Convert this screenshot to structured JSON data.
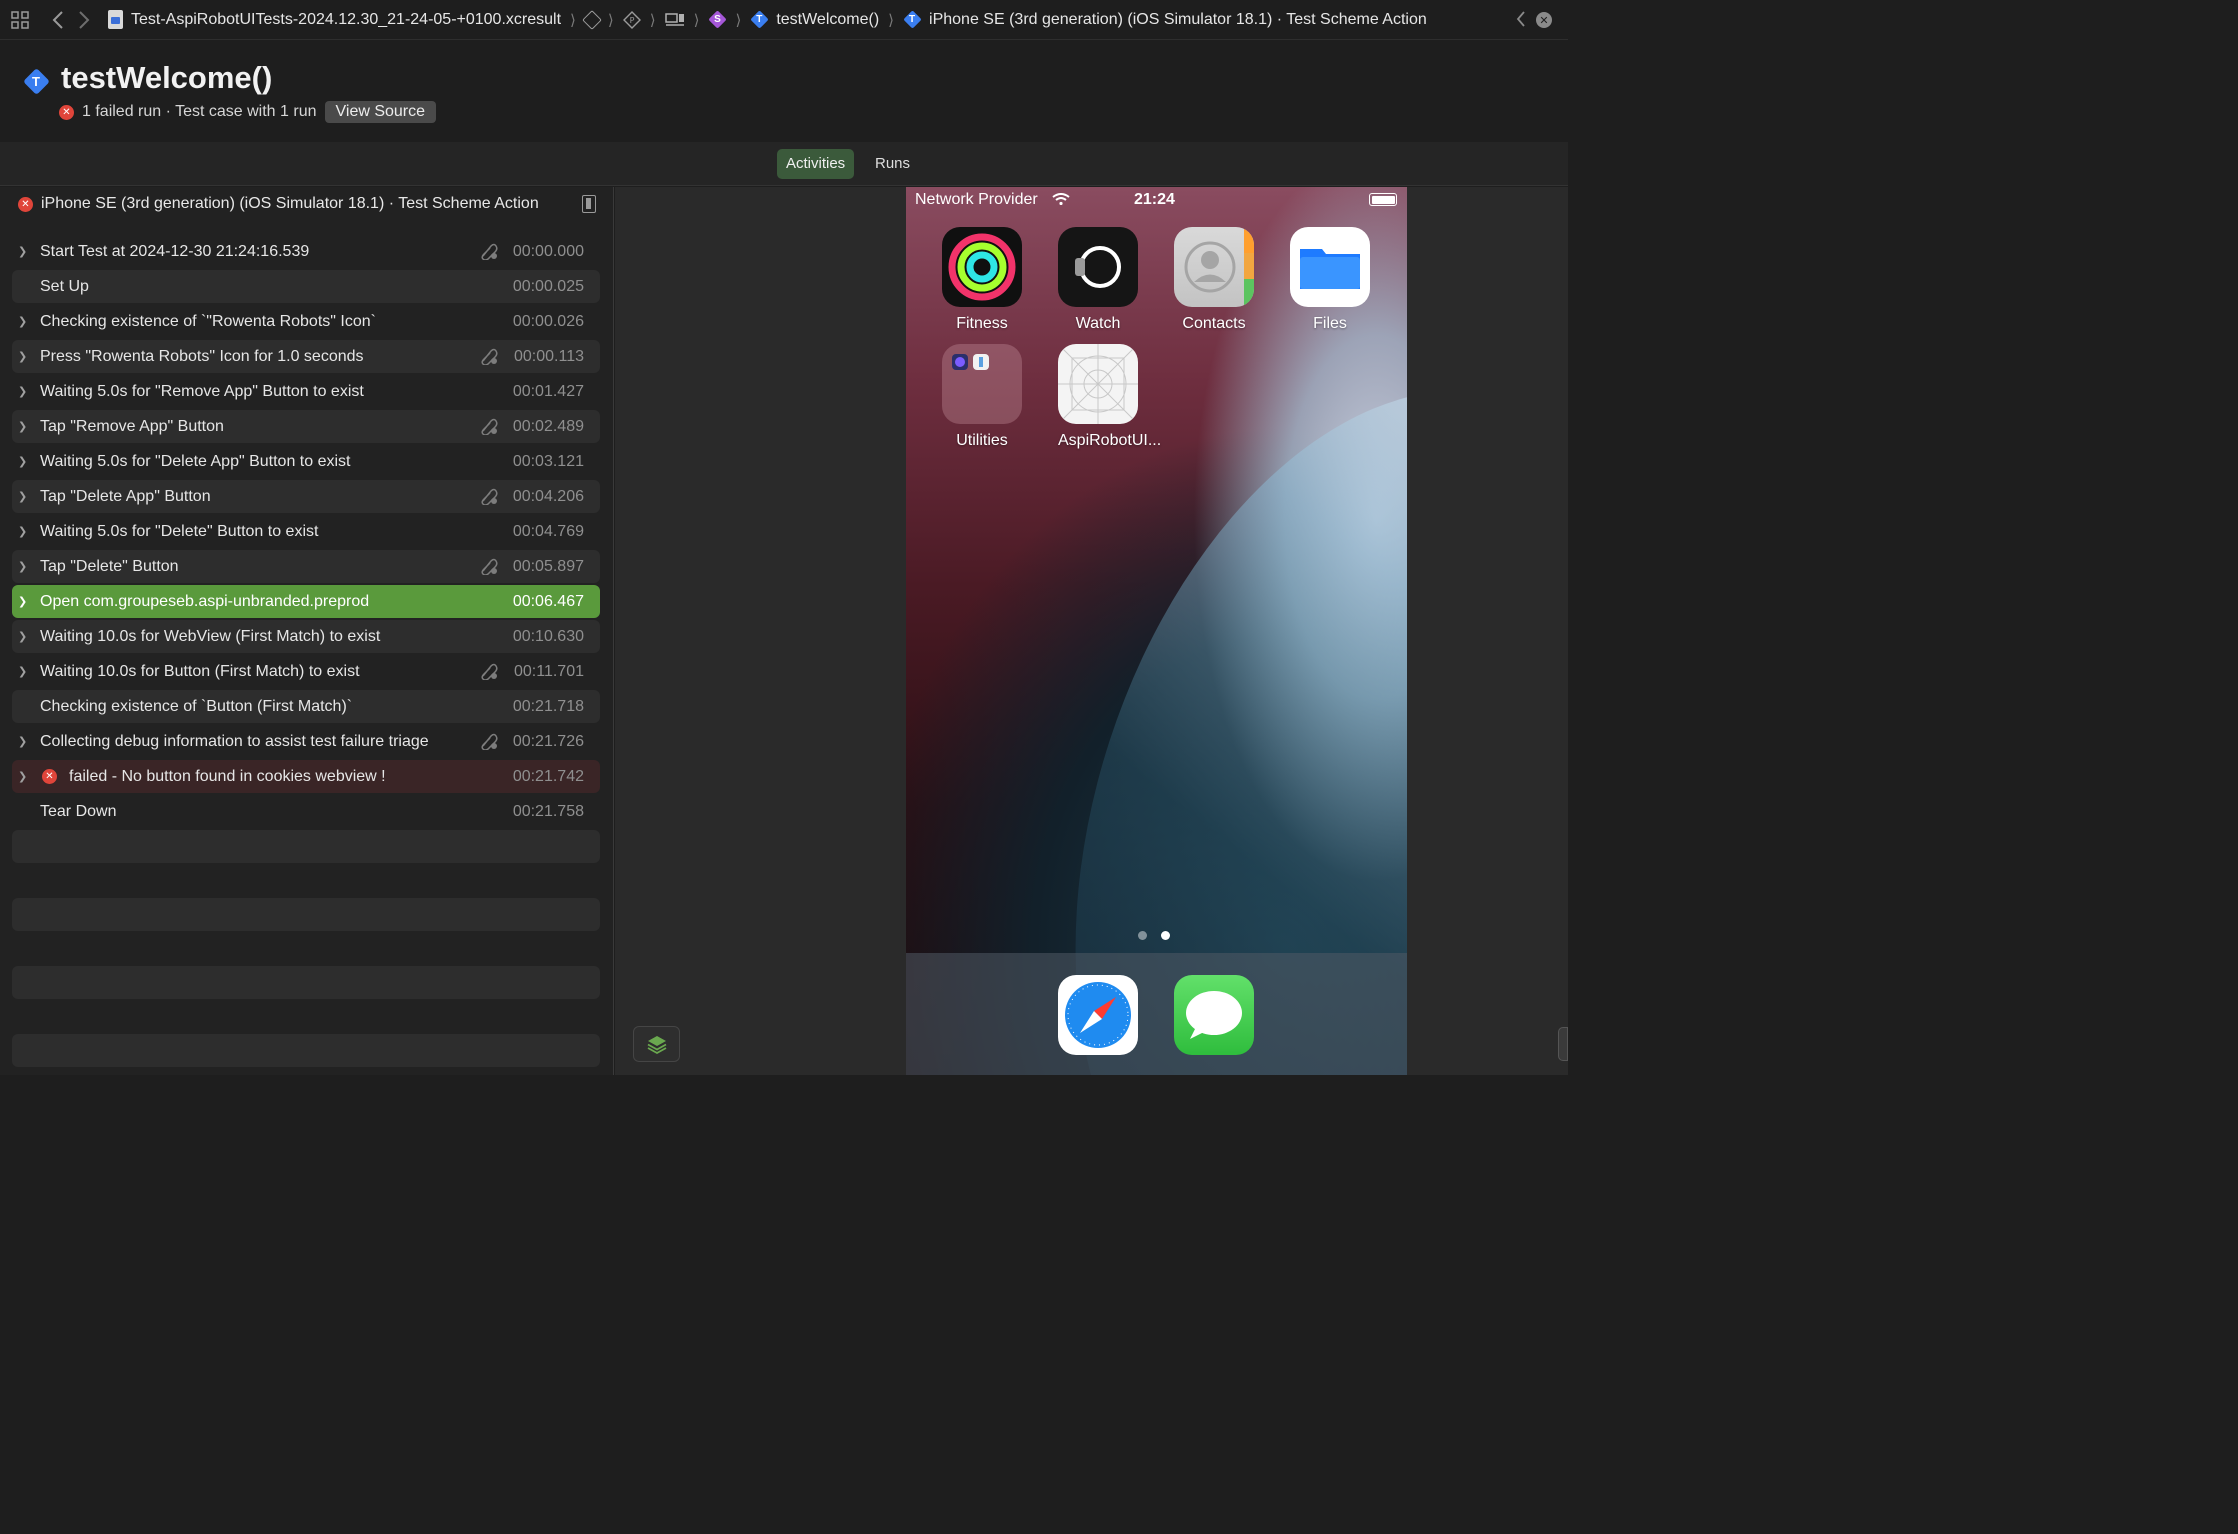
{
  "breadcrumb": {
    "file": "Test-AspiRobotUITests-2024.12.30_21-24-05-+0100.xcresult",
    "test_badge_letter": "T",
    "scheme_badge_letter": "S",
    "test": "testWelcome()",
    "destination": "iPhone SE (3rd generation) (iOS Simulator 18.1) · Test Scheme Action"
  },
  "header": {
    "badge_letter": "T",
    "title": "testWelcome()",
    "summary": "1 failed run · Test case with 1 run",
    "view_source_label": "View Source"
  },
  "tabs": {
    "activities": "Activities",
    "runs": "Runs"
  },
  "run_panel": {
    "title": "iPhone SE (3rd generation) (iOS Simulator 18.1) · Test Scheme Action",
    "activities": [
      {
        "label": "Start Test at 2024-12-30 21:24:16.539",
        "time": "00:00.000"
      },
      {
        "label": "Set Up",
        "time": "00:00.025"
      },
      {
        "label": "Checking existence of `\"Rowenta Robots\" Icon`",
        "time": "00:00.026"
      },
      {
        "label": "Press \"Rowenta Robots\" Icon for 1.0 seconds",
        "time": "00:00.113"
      },
      {
        "label": "Waiting 5.0s for \"Remove App\" Button to exist",
        "time": "00:01.427"
      },
      {
        "label": "Tap \"Remove App\" Button",
        "time": "00:02.489"
      },
      {
        "label": "Waiting 5.0s for \"Delete App\" Button to exist",
        "time": "00:03.121"
      },
      {
        "label": "Tap \"Delete App\" Button",
        "time": "00:04.206"
      },
      {
        "label": "Waiting 5.0s for \"Delete\" Button to exist",
        "time": "00:04.769"
      },
      {
        "label": "Tap \"Delete\" Button",
        "time": "00:05.897"
      },
      {
        "label": "Open com.groupeseb.aspi-unbranded.preprod",
        "time": "00:06.467"
      },
      {
        "label": "Waiting 10.0s for WebView (First Match) to exist",
        "time": "00:10.630"
      },
      {
        "label": "Waiting 10.0s for Button (First Match) to exist",
        "time": "00:11.701"
      },
      {
        "label": "Checking existence of `Button (First Match)`",
        "time": "00:21.718"
      },
      {
        "label": "Collecting debug information to assist test failure triage",
        "time": "00:21.726"
      },
      {
        "label": "failed - No button found in cookies webview !",
        "time": "00:21.742"
      },
      {
        "label": "Tear Down",
        "time": "00:21.758"
      }
    ]
  },
  "simulator": {
    "carrier": "Network Provider",
    "clock": "21:24",
    "apps": {
      "fitness": "Fitness",
      "watch": "Watch",
      "contacts": "Contacts",
      "files": "Files",
      "utilities": "Utilities",
      "aspi": "AspiRobotUI..."
    },
    "page_dots": 2,
    "current_page": 2
  },
  "colors": {
    "selected_row": "#5a9a3c",
    "failed_icon": "#e0453a",
    "test_badge": "#3a7ef0",
    "active_tab": "#3b5a3b"
  }
}
